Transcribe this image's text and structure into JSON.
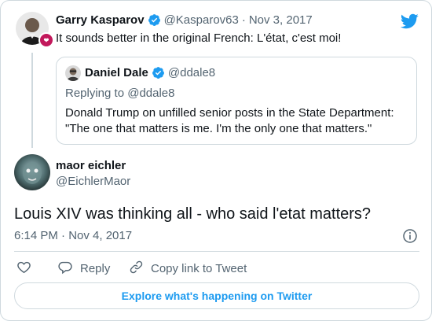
{
  "quoted_parent": {
    "author_name": "Garry Kasparov",
    "handle": "@Kasparov63",
    "separator": "·",
    "date": "Nov 3, 2017",
    "text": "It sounds better in the original French: L'état, c'est moi!"
  },
  "quote": {
    "author_name": "Daniel Dale",
    "handle": "@ddale8",
    "replying_to": "Replying to @ddale8",
    "text_line1": "Donald Trump on unfilled senior posts in the State Department:",
    "text_line2": "\"The one that matters is me. I'm the only one that matters.\""
  },
  "tweet": {
    "author_name": "maor eichler",
    "handle": "@EichlerMaor",
    "text": "Louis XIV was thinking all - who said l'etat matters?",
    "timestamp": "6:14 PM · Nov 4, 2017"
  },
  "actions": {
    "reply_label": "Reply",
    "copy_link_label": "Copy link to Tweet"
  },
  "explore_label": "Explore what's happening on Twitter",
  "colors": {
    "twitter_blue": "#1d9bf0",
    "text_primary": "#0f1419",
    "text_secondary": "#536471",
    "border": "#cfd9de"
  },
  "icons": [
    "twitter-logo-icon",
    "verified-badge-icon",
    "info-icon",
    "heart-icon",
    "reply-icon",
    "link-icon"
  ]
}
